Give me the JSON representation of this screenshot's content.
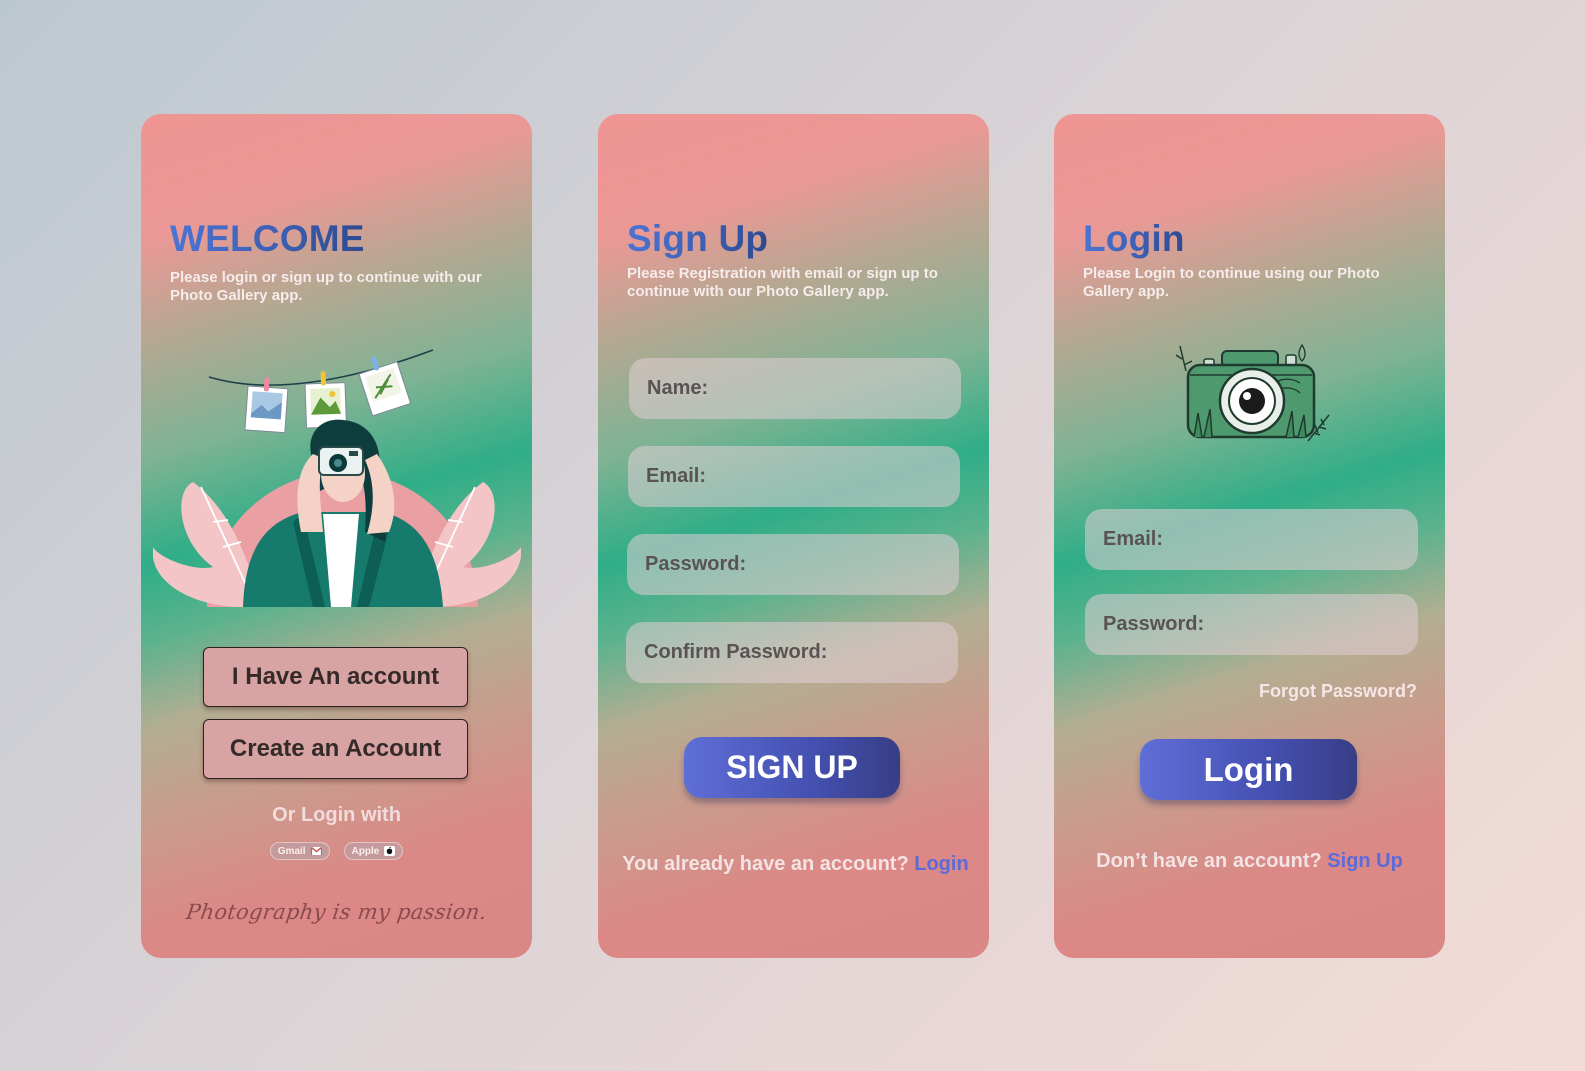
{
  "welcome": {
    "title": "WELCOME",
    "subtitle": "Please login or sign up to continue with our Photo Gallery app.",
    "have_account_label": "I Have An account",
    "create_account_label": "Create an Account",
    "or_login_label": "Or Login with",
    "social": [
      {
        "label": "Gmail",
        "icon": "gmail-icon"
      },
      {
        "label": "Apple",
        "icon": "apple-icon"
      }
    ],
    "tagline": "Photography is my passion.",
    "illustration": "woman-with-camera-illustration"
  },
  "signup": {
    "title": "Sign Up",
    "subtitle": "Please Registration with email or sign up to continue with our Photo Gallery app.",
    "fields": {
      "name": "Name:",
      "email": "Email:",
      "password": "Password:",
      "confirm": "Confirm Password:"
    },
    "submit_label": "SIGN UP",
    "bottom_prompt": "You already have an account?",
    "bottom_link": "Login"
  },
  "login": {
    "title": "Login",
    "subtitle": "Please Login to continue using our Photo Gallery app.",
    "camera_icon": "camera-icon",
    "fields": {
      "email": "Email:",
      "password": "Password:"
    },
    "forgot_label": "Forgot Password?",
    "submit_label": "Login",
    "bottom_prompt": "Don’t have an account?",
    "bottom_link": "Sign Up"
  },
  "colors": {
    "accent_blue": "#4b74d4",
    "button_gradient_start": "#5f6ed8",
    "button_gradient_end": "#373d86",
    "link_color": "#5c6bd8",
    "card_pink": "#ef9594",
    "card_green": "#2fae87"
  }
}
